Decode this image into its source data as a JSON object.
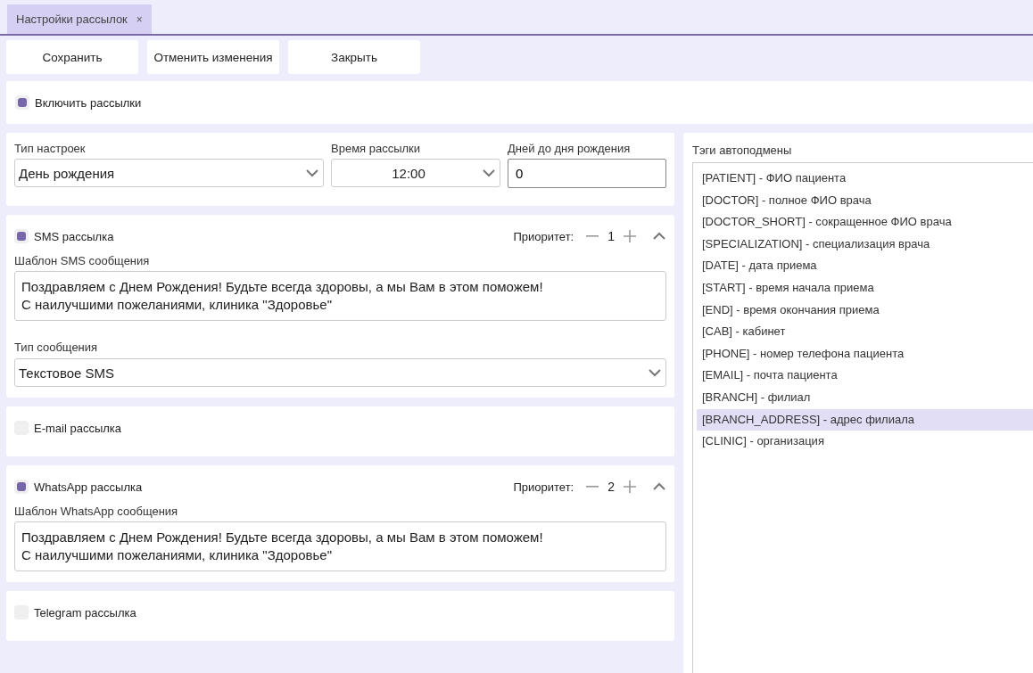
{
  "tabs": [
    {
      "label": "Настройки рассылок",
      "selected": true,
      "close": "×"
    }
  ],
  "toolbar": {
    "buttons": [
      "Сохранить",
      "Отменить изменения",
      "Закрыть"
    ]
  },
  "enable": {
    "label": "Включить рассылки",
    "checked": true
  },
  "settings": {
    "type_label": "Тип настроек",
    "type_value": "День рождения",
    "time_label": "Время рассылки",
    "time_value": "12:00",
    "days_label": "Дней до дня рождения",
    "days_value": "0"
  },
  "channels": [
    {
      "name": "SMS рассылка",
      "checked": true,
      "priority_label": "Приоритет:",
      "priority": "1",
      "template_label": "Шаблон SMS сообщения",
      "template": "Поздравляем с Днем Рождения! Будьте всегда здоровы, а мы Вам в этом поможем!\nС наилучшими пожеланиями, клиника \"Здоровье\"",
      "message_type_label": "Тип сообщения",
      "message_type": "Текстовое SMS"
    },
    {
      "name": "E-mail рассылка",
      "checked": false
    },
    {
      "name": "WhatsApp рассылка",
      "checked": true,
      "priority_label": "Приоритет:",
      "priority": "2",
      "template_label": "Шаблон WhatsApp сообщения",
      "template": "Поздравляем с Днем Рождения! Будьте всегда здоровы, а мы Вам в этом поможем!\nС наилучшими пожеланиями, клиника \"Здоровье\""
    },
    {
      "name": "Telegram рассылка",
      "checked": false
    }
  ],
  "tags": {
    "title": "Тэги автоподмены",
    "items": [
      {
        "label": "[PATIENT] - ФИО пациента",
        "selected": false
      },
      {
        "label": "[DOCTOR] - полное ФИО врача",
        "selected": false
      },
      {
        "label": "[DOCTOR_SHORT] - сокращенное ФИО врача",
        "selected": false
      },
      {
        "label": "[SPECIALIZATION] - специализация врача",
        "selected": false
      },
      {
        "label": "[DATE] - дата приема",
        "selected": false
      },
      {
        "label": "[START] - время начала приема",
        "selected": false
      },
      {
        "label": "[END] - время окончания приема",
        "selected": false
      },
      {
        "label": "[CAB] - кабинет",
        "selected": false
      },
      {
        "label": "[PHONE] - номер телефона пациента",
        "selected": false
      },
      {
        "label": "[EMAIL] - почта пациента",
        "selected": false
      },
      {
        "label": "[BRANCH] - филиал",
        "selected": false
      },
      {
        "label": "[BRANCH_ADDRESS] - адрес филиала",
        "selected": true
      },
      {
        "label": "[CLINIC] - организация",
        "selected": false
      }
    ]
  }
}
